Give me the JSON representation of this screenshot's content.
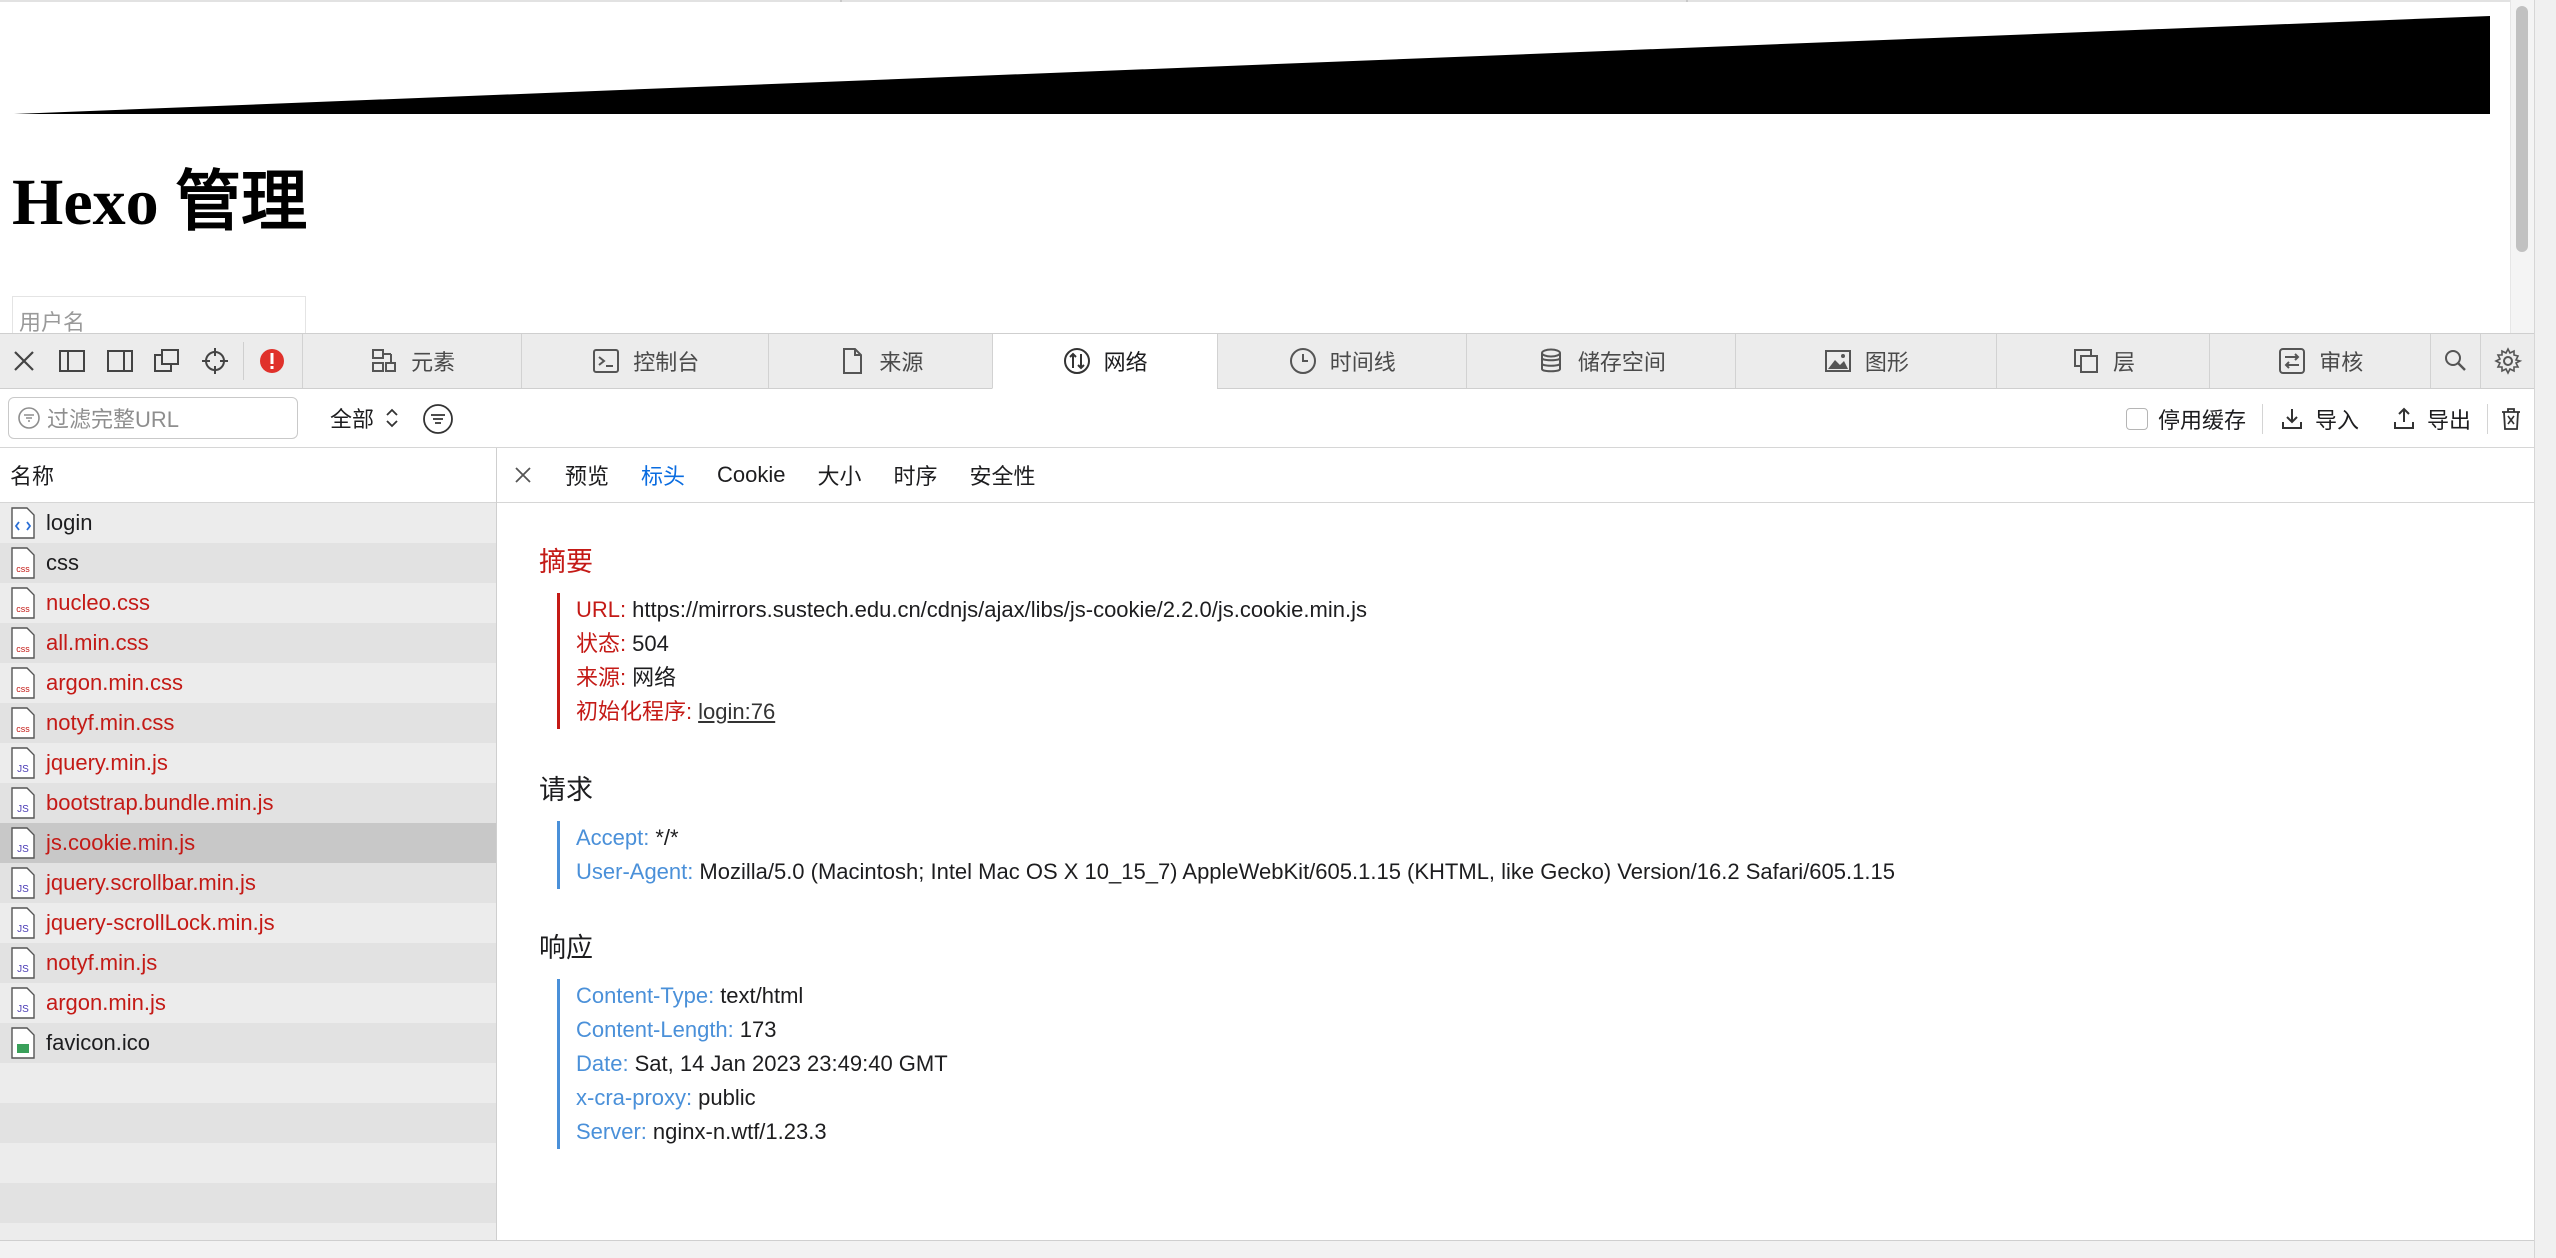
{
  "page": {
    "title": "Hexo 管理",
    "username_placeholder": "用户名"
  },
  "devtools": {
    "tabs": [
      {
        "label": "元素",
        "icon": "elements-icon"
      },
      {
        "label": "控制台",
        "icon": "console-icon"
      },
      {
        "label": "来源",
        "icon": "sources-icon"
      },
      {
        "label": "网络",
        "icon": "network-icon",
        "active": true
      },
      {
        "label": "时间线",
        "icon": "timeline-icon"
      },
      {
        "label": "储存空间",
        "icon": "storage-icon"
      },
      {
        "label": "图形",
        "icon": "graphics-icon"
      },
      {
        "label": "层",
        "icon": "layers-icon"
      },
      {
        "label": "审核",
        "icon": "audit-icon"
      }
    ],
    "filter": {
      "placeholder": "过滤完整URL",
      "type_selected": "全部"
    },
    "tools": {
      "disable_cache": "停用缓存",
      "import": "导入",
      "export": "导出"
    }
  },
  "request_list": {
    "header": "名称",
    "items": [
      {
        "name": "login",
        "type": "html",
        "error": false
      },
      {
        "name": "css",
        "type": "css",
        "error": false
      },
      {
        "name": "nucleo.css",
        "type": "css",
        "error": true
      },
      {
        "name": "all.min.css",
        "type": "css",
        "error": true
      },
      {
        "name": "argon.min.css",
        "type": "css",
        "error": true
      },
      {
        "name": "notyf.min.css",
        "type": "css",
        "error": true
      },
      {
        "name": "jquery.min.js",
        "type": "js",
        "error": true
      },
      {
        "name": "bootstrap.bundle.min.js",
        "type": "js",
        "error": true
      },
      {
        "name": "js.cookie.min.js",
        "type": "js",
        "error": true,
        "selected": true
      },
      {
        "name": "jquery.scrollbar.min.js",
        "type": "js",
        "error": true
      },
      {
        "name": "jquery-scrollLock.min.js",
        "type": "js",
        "error": true
      },
      {
        "name": "notyf.min.js",
        "type": "js",
        "error": true
      },
      {
        "name": "argon.min.js",
        "type": "js",
        "error": true
      },
      {
        "name": "favicon.ico",
        "type": "image",
        "error": false
      }
    ]
  },
  "details": {
    "tabs": [
      "预览",
      "标头",
      "Cookie",
      "大小",
      "时序",
      "安全性"
    ],
    "active_tab": "标头",
    "summary": {
      "title": "摘要",
      "url_key": "URL:",
      "url": "https://mirrors.sustech.edu.cn/cdnjs/ajax/libs/js-cookie/2.2.0/js.cookie.min.js",
      "status_key": "状态:",
      "status": "504",
      "source_key": "来源:",
      "source": "网络",
      "initiator_key": "初始化程序:",
      "initiator": "login:76"
    },
    "request": {
      "title": "请求",
      "headers": [
        {
          "key": "Accept:",
          "value": "*/*"
        },
        {
          "key": "User-Agent:",
          "value": "Mozilla/5.0 (Macintosh; Intel Mac OS X 10_15_7) AppleWebKit/605.1.15 (KHTML, like Gecko) Version/16.2 Safari/605.1.15"
        }
      ]
    },
    "response": {
      "title": "响应",
      "headers": [
        {
          "key": "Content-Type:",
          "value": "text/html"
        },
        {
          "key": "Content-Length:",
          "value": "173"
        },
        {
          "key": "Date:",
          "value": "Sat, 14 Jan 2023 23:49:40 GMT"
        },
        {
          "key": "x-cra-proxy:",
          "value": "public"
        },
        {
          "key": "Server:",
          "value": "nginx-n.wtf/1.23.3"
        }
      ]
    }
  },
  "colors": {
    "error_red": "#c41a16",
    "header_key_blue": "#4a90d9",
    "active_tab_blue": "#0a6ce0"
  }
}
